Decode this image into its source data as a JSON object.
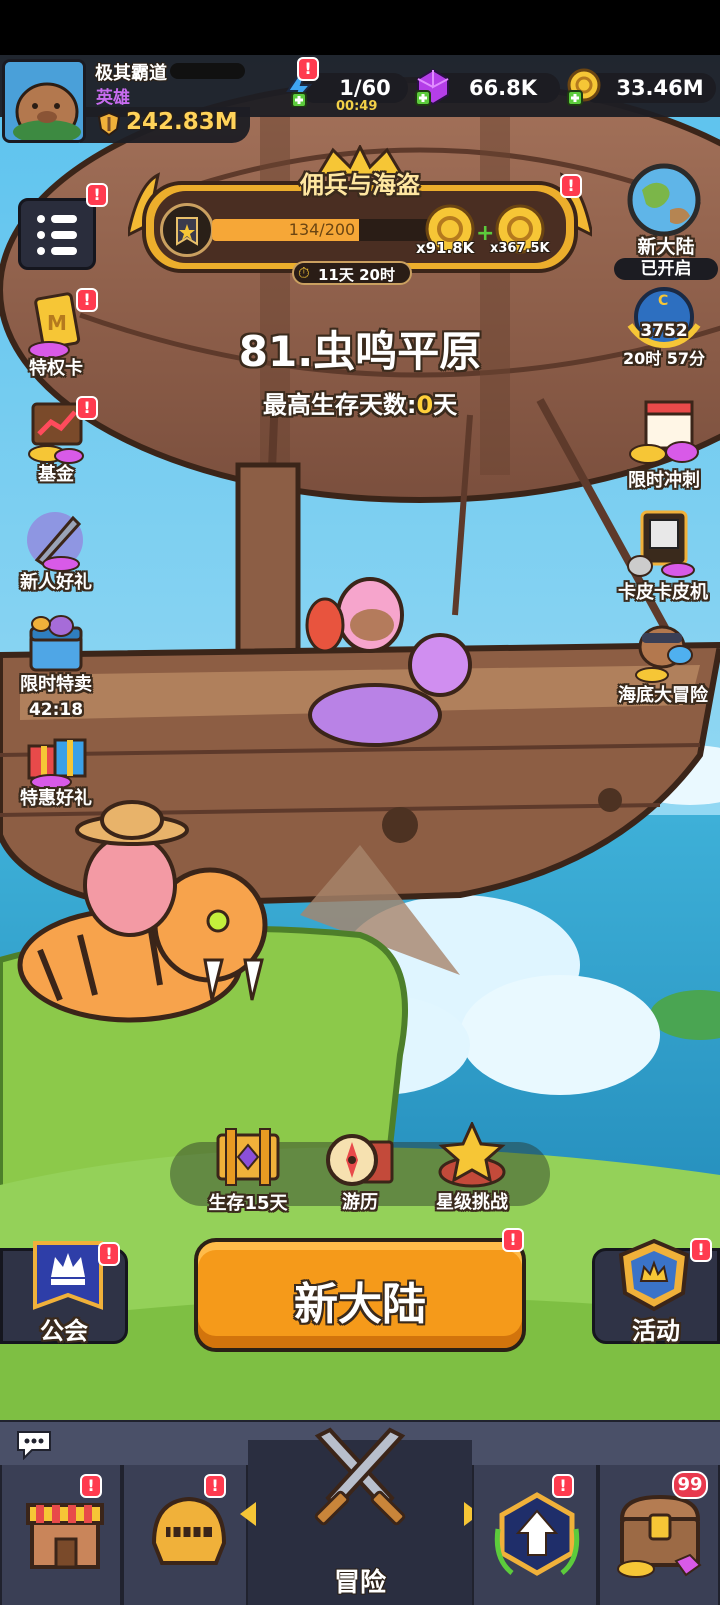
{
  "player": {
    "name": "极其霸道",
    "title": "英雄",
    "power": "242.83M"
  },
  "resources": {
    "energy": "1/60",
    "energy_timer": "00:49",
    "gems": "66.8K",
    "coins": "33.46M"
  },
  "event_banner": {
    "title": "佣兵与海盗",
    "progress_text": "134/200",
    "progress": 0.67,
    "reward1": "x91.8K",
    "reward2": "x367.5K",
    "timer": "11天 20时"
  },
  "level": {
    "name": "81.虫鸣平原",
    "best_label": "最高生存天数:",
    "best_value": "0",
    "best_unit": "天"
  },
  "left_menu": [
    {
      "label": "特权卡"
    },
    {
      "label": "基金"
    },
    {
      "label": "新人好礼"
    },
    {
      "label": "限时特卖",
      "timer": "42:18"
    },
    {
      "label": "特惠好礼"
    }
  ],
  "right_menu": {
    "new_continent": {
      "label": "新大陆",
      "status": "已开启"
    },
    "rank": {
      "value": "3752",
      "timer": "20时 57分"
    },
    "items": [
      {
        "label": "限时冲刺"
      },
      {
        "label": "卡皮卡皮机"
      },
      {
        "label": "海底大冒险"
      }
    ]
  },
  "quick_actions": [
    {
      "label": "生存15天"
    },
    {
      "label": "游历"
    },
    {
      "label": "星级挑战"
    }
  ],
  "main_buttons": {
    "guild": "公会",
    "start": "新大陆",
    "activity": "活动"
  },
  "bottom_nav": {
    "center_label": "冒险",
    "chest_count": "99"
  },
  "colors": {
    "accent_orange": "#f59a1a",
    "badge_red": "#ff3b4f",
    "gold": "#f6c636",
    "sky": "#7fd3f2",
    "grass": "#8cc94a",
    "nav_bg": "#3a3f55"
  }
}
